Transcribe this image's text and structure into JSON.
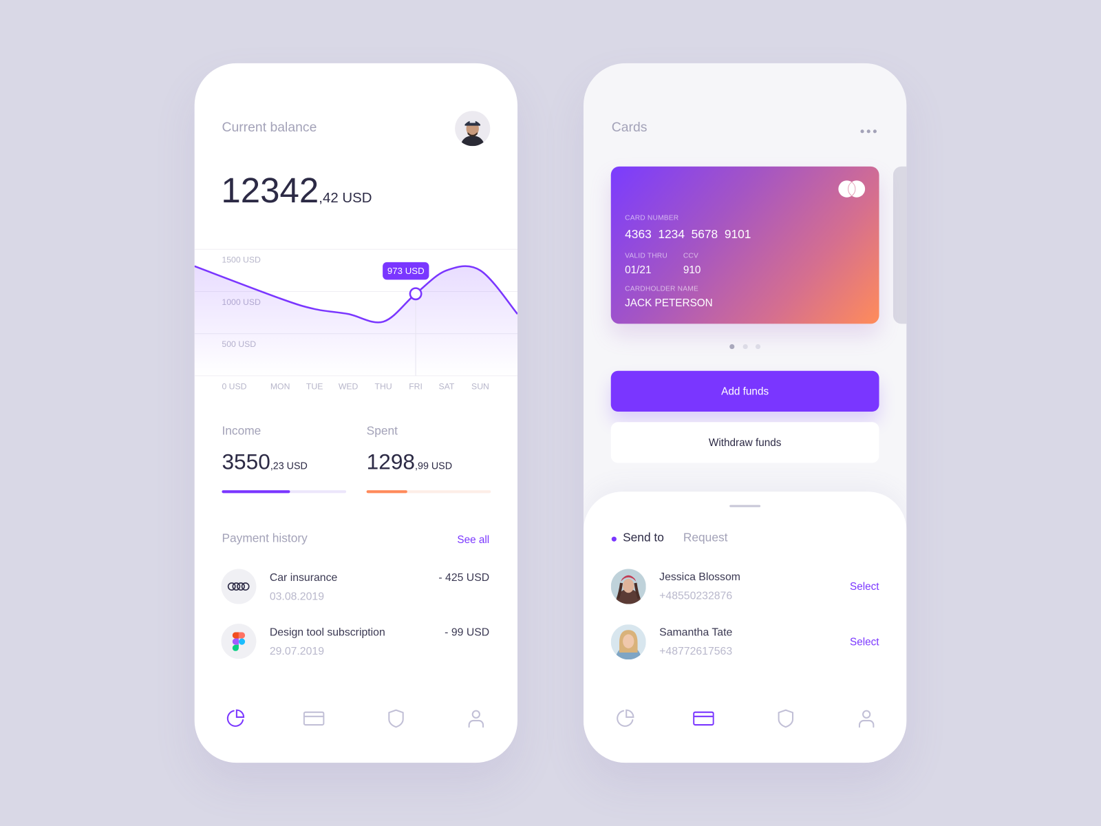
{
  "colors": {
    "accent": "#7a36ff",
    "orange": "#ff8a5b",
    "background": "#d9d8e6"
  },
  "balance": {
    "title": "Current balance",
    "amount_int": "12342",
    "amount_dec": ",42 USD",
    "avatar_icon": "user-avatar"
  },
  "chart_data": {
    "type": "area",
    "categories": [
      "MON",
      "TUE",
      "WED",
      "THU",
      "FRI",
      "SAT",
      "SUN"
    ],
    "values": [
      917,
      792,
      733,
      642,
      973,
      1250,
      1250
    ],
    "leading_value": 1300,
    "trailing_value": 733,
    "y_ticks": [
      "1500 USD",
      "1000 USD",
      "500 USD",
      "0 USD"
    ],
    "ylim": [
      0,
      1500
    ],
    "grid": true,
    "highlight": {
      "category": "FRI",
      "label": "973 USD"
    }
  },
  "income": {
    "label": "Income",
    "int": "3550",
    "dec": ",23 USD",
    "progress": 0.55
  },
  "spent": {
    "label": "Spent",
    "int": "1298",
    "dec": ",99 USD",
    "progress": 0.33
  },
  "payments": {
    "title": "Payment history",
    "see_all": "See all",
    "items": [
      {
        "title": "Car insurance",
        "date": "03.08.2019",
        "amount": "- 425 USD",
        "icon": "audi-rings-icon"
      },
      {
        "title": "Design tool subscription",
        "date": "29.07.2019",
        "amount": "- 99 USD",
        "icon": "figma-icon"
      }
    ]
  },
  "nav": {
    "items": [
      "chart-pie-icon",
      "card-icon",
      "shield-icon",
      "user-icon"
    ]
  },
  "cards": {
    "title": "Cards",
    "more_icon": "more-horizontal-icon",
    "card": {
      "number_label": "CARD NUMBER",
      "number": "4363  1234  5678  9101",
      "valid_label": "VALID THRU",
      "valid": "01/21",
      "ccv_label": "CCV",
      "ccv": "910",
      "holder_label": "CARDHOLDER NAME",
      "holder": "JACK PETERSON"
    },
    "page_index": 0,
    "page_count": 3,
    "add_funds": "Add funds",
    "withdraw_funds": "Withdraw funds"
  },
  "transfer": {
    "tabs": [
      "Send to",
      "Request"
    ],
    "active_tab": 0,
    "contacts": [
      {
        "name": "Jessica Blossom",
        "phone": "+48550232876",
        "action": "Select"
      },
      {
        "name": "Samantha Tate",
        "phone": "+48772617563",
        "action": "Select"
      }
    ]
  }
}
